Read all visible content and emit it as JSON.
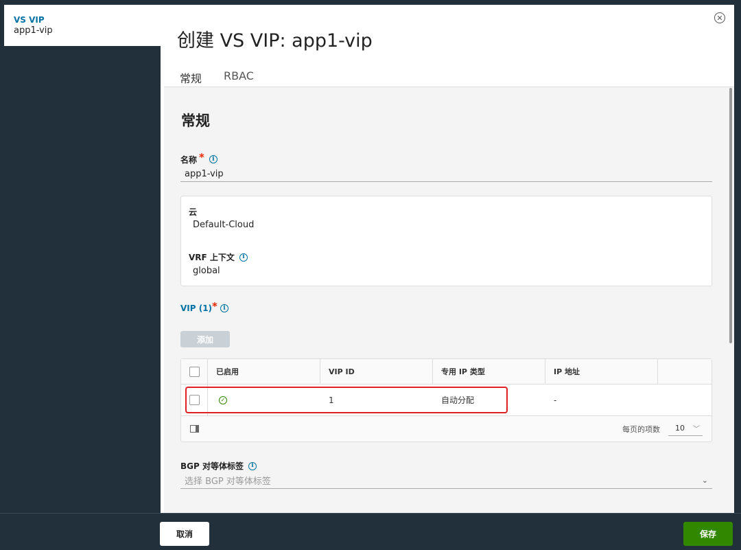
{
  "breadcrumb": {
    "title": "VS VIP",
    "subtitle": "app1-vip"
  },
  "modal": {
    "title": "创建 VS VIP: app1-vip",
    "close_icon": "close-circle-icon",
    "tabs": [
      {
        "label": "常规",
        "active": true
      },
      {
        "label": "RBAC",
        "active": false
      }
    ]
  },
  "general": {
    "section_title": "常规",
    "name": {
      "label": "名称",
      "value": "app1-vip"
    },
    "cloud": {
      "label": "云",
      "value": "Default-Cloud"
    },
    "vrf": {
      "label": "VRF 上下文",
      "value": "global"
    }
  },
  "vip": {
    "label": "VIP (1)",
    "add_label": "添加",
    "columns": [
      "已启用",
      "VIP ID",
      "专用 IP 类型",
      "IP 地址"
    ],
    "rows": [
      {
        "enabled_icon": "check-circle-icon",
        "vip_id": "1",
        "private_ip_type": "自动分配",
        "ip_address": "-"
      }
    ],
    "footer": {
      "page_size_label": "每页的项数",
      "page_size_value": "10"
    }
  },
  "bgp": {
    "label": "BGP 对等体标签",
    "placeholder": "选择 BGP 对等体标签"
  },
  "actions": {
    "cancel_label": "取消",
    "save_label": "保存"
  },
  "colors": {
    "accent": "#0072a3",
    "save": "#318700",
    "required": "#e62700",
    "highlight": "#e02020",
    "background": "#22303c"
  }
}
